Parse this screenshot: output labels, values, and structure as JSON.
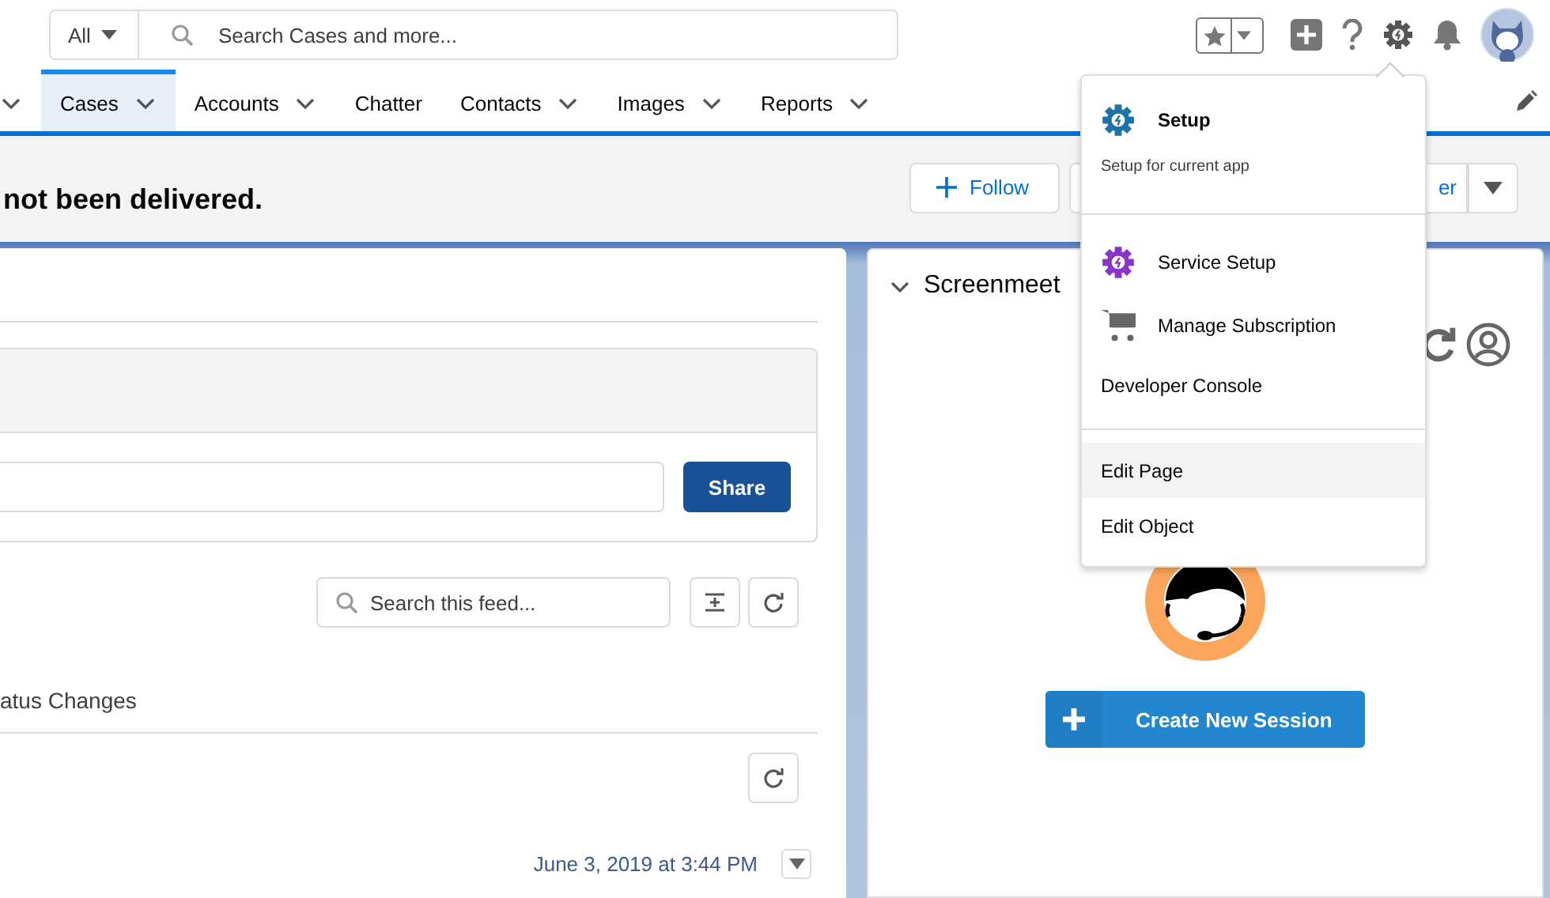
{
  "header": {
    "search": {
      "scope": "All",
      "placeholder": "Search Cases and more..."
    }
  },
  "nav": {
    "tabs": [
      {
        "label": "Cases",
        "selected": true,
        "menu": true
      },
      {
        "label": "Accounts",
        "selected": false,
        "menu": true
      },
      {
        "label": "Chatter",
        "selected": false,
        "menu": false
      },
      {
        "label": "Contacts",
        "selected": false,
        "menu": true
      },
      {
        "label": "Images",
        "selected": false,
        "menu": true
      },
      {
        "label": "Reports",
        "selected": false,
        "menu": true
      }
    ]
  },
  "record": {
    "title": "not been delivered.",
    "follow_button": "Follow",
    "partial_button": "er"
  },
  "feed": {
    "share_button": "Share",
    "search_placeholder": "Search this feed...",
    "filter": "atus Changes",
    "timestamp": "June 3, 2019 at 3:44 PM"
  },
  "screenmeet": {
    "title": "Screenmeet",
    "expanded": true,
    "button": "Create New Session"
  },
  "setup_menu": {
    "sections": [
      [
        {
          "kind": "setup",
          "label": "Setup",
          "subtitle": "Setup for current app",
          "highlighted": false
        }
      ],
      [
        {
          "kind": "service",
          "label": "Service Setup",
          "highlighted": false
        },
        {
          "kind": "subscription",
          "label": "Manage Subscription",
          "highlighted": false
        },
        {
          "kind": "plain",
          "label": "Developer Console",
          "highlighted": false
        }
      ],
      [
        {
          "kind": "plain",
          "label": "Edit Page",
          "highlighted": true
        },
        {
          "kind": "plain",
          "label": "Edit Object",
          "highlighted": false
        }
      ]
    ]
  }
}
